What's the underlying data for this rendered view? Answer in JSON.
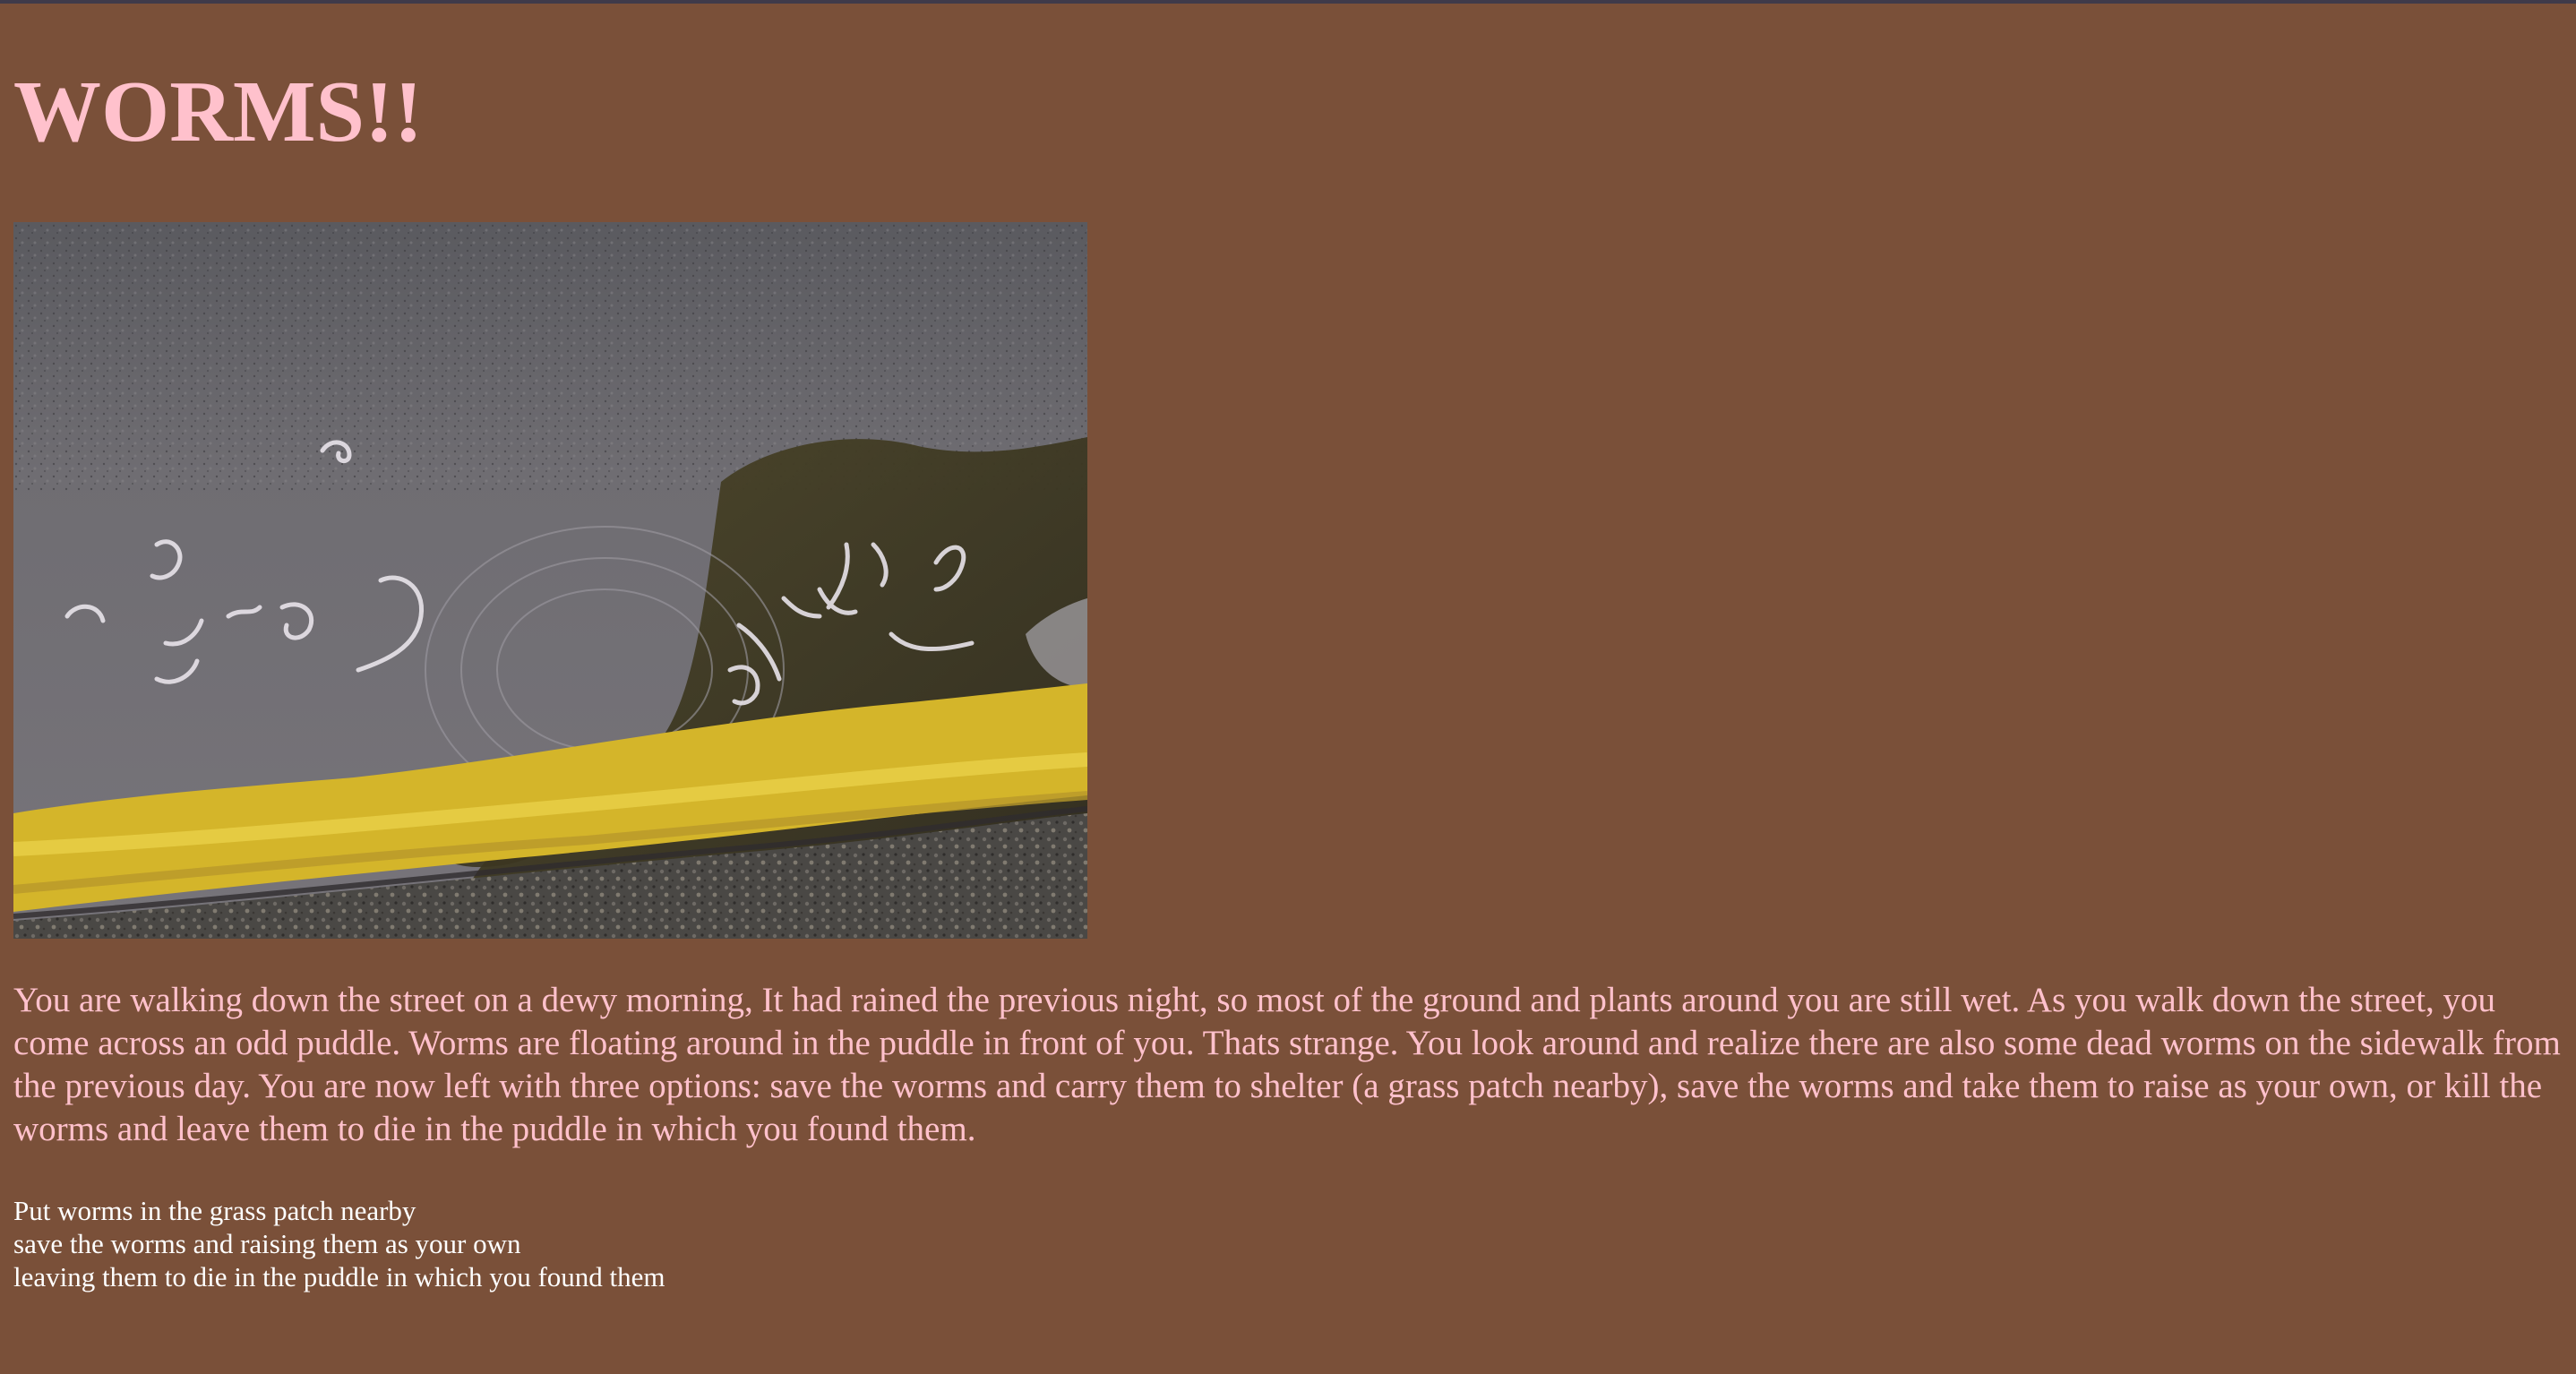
{
  "page": {
    "title": "WORMS!!",
    "story": "You are walking down the street on a dewy morning, It had rained the previous night, so most of the ground and plants around you are still wet. As you walk down the street, you come across an odd puddle. Worms are floating around in the puddle in front of you. Thats strange. You look around and realize there are also some dead worms on the sidewalk from the previous day. You are now left with three options: save the worms and carry them to shelter (a grass patch nearby), save the worms and take them to raise as your own, or kill the worms and leave them to die in the puddle in which you found them.",
    "options": [
      "Put worms in the grass patch nearby",
      "save the worms and raising them as your own",
      "leaving them to die in the puddle in which you found them"
    ]
  },
  "colors": {
    "background": "#7a5039",
    "title": "#ffc1cc",
    "story_text": "#ffc1cc",
    "options_text": "#ffffff",
    "top_bar": "#3f3a4a"
  }
}
